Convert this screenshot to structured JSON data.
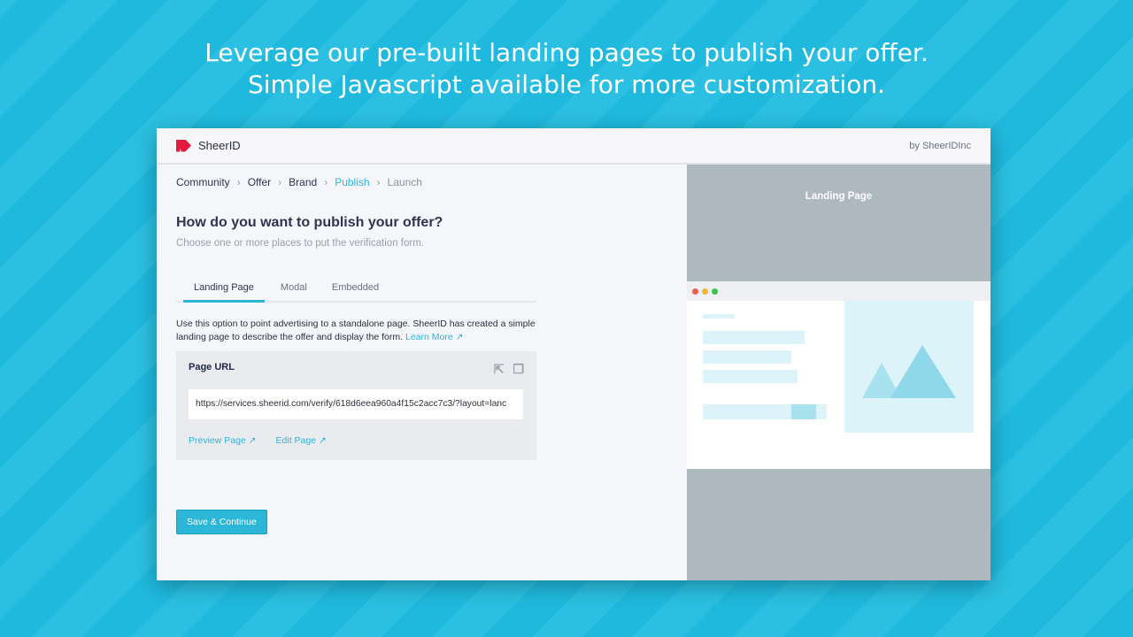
{
  "headline": {
    "line1": "Leverage our pre-built landing pages to publish your offer.",
    "line2": "Simple Javascript available for more customization."
  },
  "app": {
    "brand": "SheerID",
    "by": "by SheerIDInc"
  },
  "breadcrumb": [
    {
      "label": "Community"
    },
    {
      "label": "Offer"
    },
    {
      "label": "Brand"
    },
    {
      "label": "Publish",
      "state": "active"
    },
    {
      "label": "Launch",
      "state": "disabled"
    }
  ],
  "page": {
    "title": "How do you want to publish your offer?",
    "subtitle": "Choose one or more places to put the verification form."
  },
  "tabs": [
    {
      "label": "Landing Page",
      "selected": true
    },
    {
      "label": "Modal"
    },
    {
      "label": "Embedded"
    }
  ],
  "description": {
    "text": "Use this option to point advertising to a standalone page. SheerID has created a simple landing page to describe the offer and display the form.",
    "learn_more": "Learn More"
  },
  "card": {
    "title": "Page URL",
    "url": "https://services.sheerid.com/verify/618d6eea960a4f15c2acc7c3/?layout=lanc",
    "preview": "Preview Page",
    "edit": "Edit Page",
    "icons": [
      "external-link-icon",
      "copy-icon"
    ]
  },
  "save_label": "Save & Continue",
  "preview": {
    "title": "Landing Page"
  },
  "colors": {
    "accent": "#2cb6d8",
    "brand": "#e4193f",
    "background": "#20b9de"
  }
}
